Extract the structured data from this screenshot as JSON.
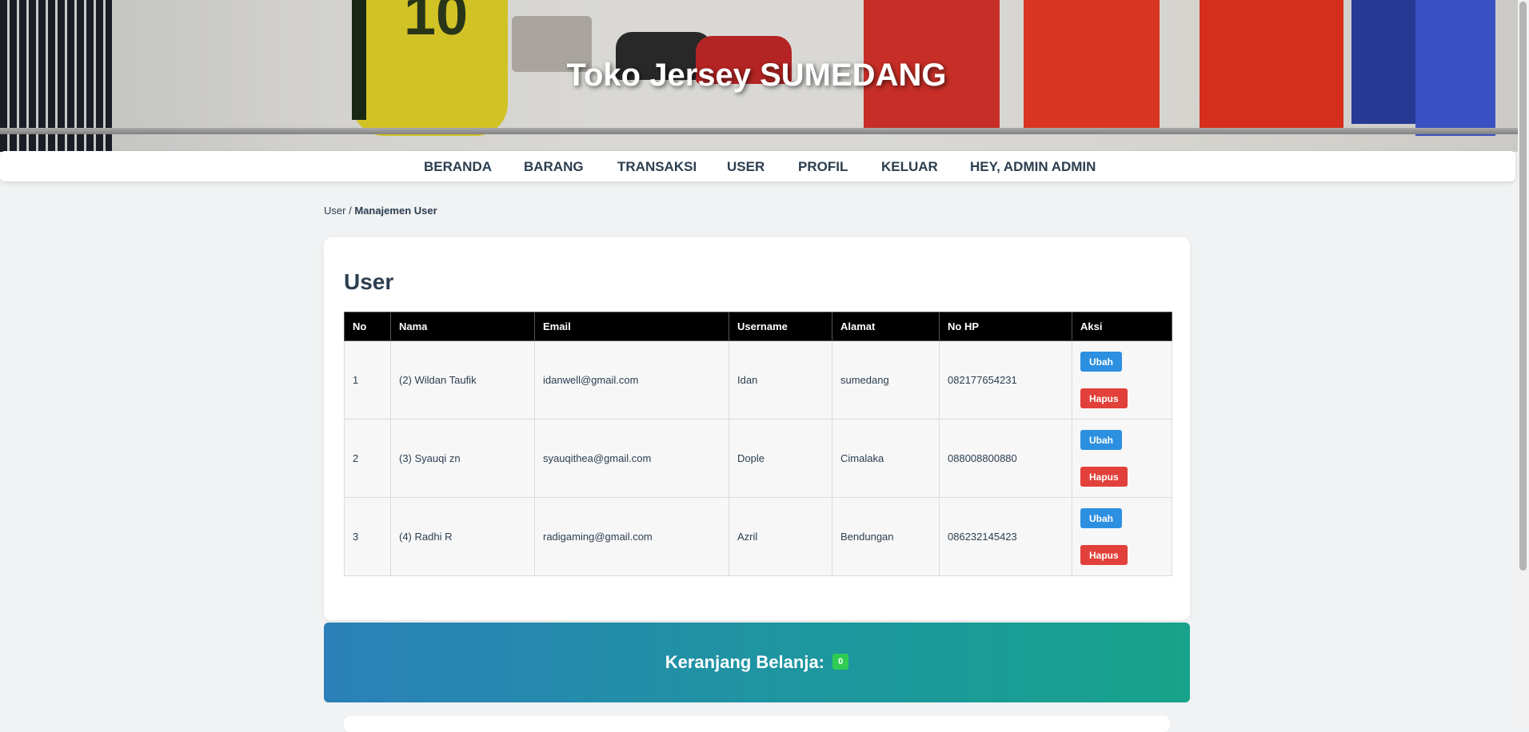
{
  "header": {
    "title": "Toko Jersey SUMEDANG"
  },
  "nav": {
    "items": [
      {
        "label": "BERANDA"
      },
      {
        "label": "BARANG"
      },
      {
        "label": "TRANSAKSI"
      },
      {
        "label": "USER"
      },
      {
        "label": "PROFIL"
      },
      {
        "label": "KELUAR"
      },
      {
        "label": "HEY, ADMIN ADMIN"
      }
    ]
  },
  "breadcrumb": {
    "parent": "User",
    "separator": "/",
    "current": "Manajemen User"
  },
  "main": {
    "heading": "User",
    "table": {
      "columns": [
        "No",
        "Nama",
        "Email",
        "Username",
        "Alamat",
        "No HP",
        "Aksi"
      ],
      "rows": [
        {
          "no": "1",
          "nama": "(2) Wildan Taufik",
          "email": "idanwell@gmail.com",
          "username": "Idan",
          "alamat": "sumedang",
          "no_hp": "082177654231"
        },
        {
          "no": "2",
          "nama": "(3) Syauqi zn",
          "email": "syauqithea@gmail.com",
          "username": "Dople",
          "alamat": "Cimalaka",
          "no_hp": "088008800880"
        },
        {
          "no": "3",
          "nama": "(4) Radhi R",
          "email": "radigaming@gmail.com",
          "username": "Azril",
          "alamat": "Bendungan",
          "no_hp": "086232145423"
        }
      ],
      "actions": {
        "edit_label": "Ubah",
        "delete_label": "Hapus"
      }
    }
  },
  "cart": {
    "label": "Keranjang Belanja:",
    "count": "0"
  },
  "colors": {
    "edit": "#2c8fe0",
    "delete": "#e2403a",
    "badge": "#2ecc52",
    "header_row": "#000000"
  },
  "icons": []
}
